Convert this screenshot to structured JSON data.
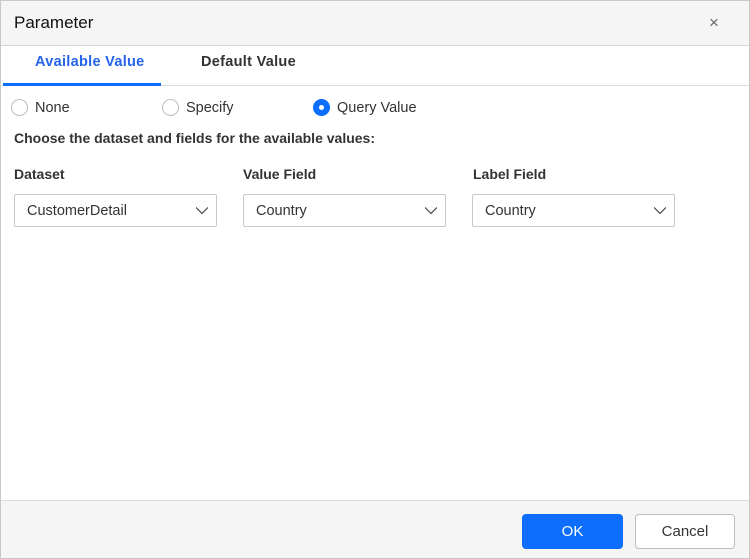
{
  "dialog": {
    "title": "Parameter",
    "close_icon": "×"
  },
  "tabs": [
    {
      "label": "Available Value",
      "active": true
    },
    {
      "label": "Default Value",
      "active": false
    }
  ],
  "radios": [
    {
      "label": "None",
      "checked": false
    },
    {
      "label": "Specify",
      "checked": false
    },
    {
      "label": "Query Value",
      "checked": true
    }
  ],
  "description": "Choose the dataset and fields for the available values:",
  "fields": [
    {
      "label": "Dataset",
      "value": "CustomerDetail"
    },
    {
      "label": "Value Field",
      "value": "Country"
    },
    {
      "label": "Label Field",
      "value": "Country"
    }
  ],
  "footer": {
    "ok": "OK",
    "cancel": "Cancel"
  }
}
